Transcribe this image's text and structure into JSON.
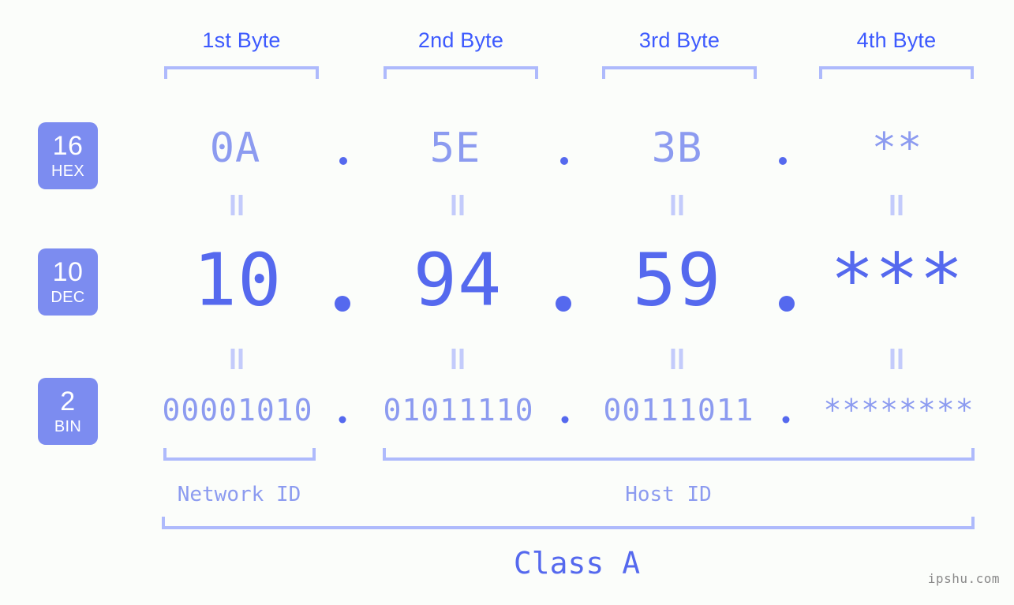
{
  "page": {
    "background_color": "#fbfdfa",
    "watermark": "ipshu.com"
  },
  "colors": {
    "header_blue": "#3d5afe",
    "bracket_blue": "#aebafc",
    "badge_bg": "#7c8cf0",
    "value_light": "#8c9bf0",
    "value_strong": "#5569ee",
    "eq_mark": "#c3cbfb",
    "watermark_gray": "#8a8a8a"
  },
  "byte_headers": [
    {
      "label": "1st Byte"
    },
    {
      "label": "2nd Byte"
    },
    {
      "label": "3rd Byte"
    },
    {
      "label": "4th Byte"
    }
  ],
  "rows": [
    {
      "key": "hex",
      "badge_number": "16",
      "badge_abbr": "HEX",
      "values": [
        "0A",
        "5E",
        "3B",
        "**"
      ],
      "separator": "."
    },
    {
      "key": "dec",
      "badge_number": "10",
      "badge_abbr": "DEC",
      "values": [
        "10",
        "94",
        "59",
        "***"
      ],
      "separator": "."
    },
    {
      "key": "bin",
      "badge_number": "2",
      "badge_abbr": "BIN",
      "values": [
        "00001010",
        "01011110",
        "00111011",
        "********"
      ],
      "separator": "."
    }
  ],
  "segments": {
    "network_id": "Network ID",
    "host_id": "Host ID",
    "class": "Class A"
  }
}
